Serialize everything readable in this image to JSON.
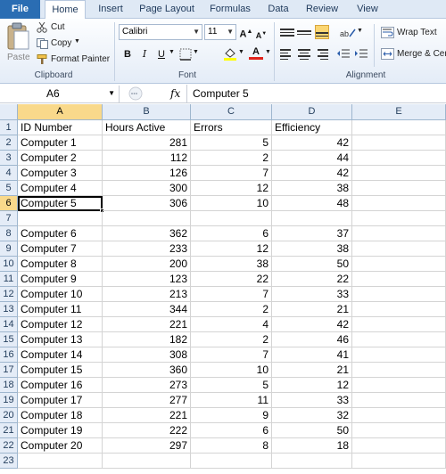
{
  "tabs": [
    "File",
    "Home",
    "Insert",
    "Page Layout",
    "Formulas",
    "Data",
    "Review",
    "View"
  ],
  "clipboard": {
    "paste_label": "Paste",
    "cut_label": "Cut",
    "copy_label": "Copy",
    "format_painter_label": "Format Painter",
    "group_label": "Clipboard"
  },
  "font": {
    "family": "Calibri",
    "size": "11",
    "bold": "B",
    "italic": "I",
    "underline": "U",
    "grow": "A",
    "shrink": "A",
    "color_glyph": "A",
    "group_label": "Font",
    "fill_color": "#ffff00",
    "font_color": "#e0231c"
  },
  "alignment": {
    "wrap_label": "Wrap Text",
    "merge_label": "Merge & Cer",
    "group_label": "Alignment"
  },
  "formula_bar": {
    "name_box": "A6",
    "fx": "fx",
    "content": "Computer 5"
  },
  "columns": [
    "A",
    "B",
    "C",
    "D",
    "E"
  ],
  "rows": [
    {
      "n": "1",
      "a": "ID Number",
      "b": "Hours Active",
      "c": "Errors",
      "d": "Efficiency"
    },
    {
      "n": "2",
      "a": "Computer 1",
      "b": "281",
      "c": "5",
      "d": "42"
    },
    {
      "n": "3",
      "a": "Computer 2",
      "b": "112",
      "c": "2",
      "d": "44"
    },
    {
      "n": "4",
      "a": "Computer 3",
      "b": "126",
      "c": "7",
      "d": "42"
    },
    {
      "n": "5",
      "a": "Computer 4",
      "b": "300",
      "c": "12",
      "d": "38"
    },
    {
      "n": "6",
      "a": "Computer 5",
      "b": "306",
      "c": "10",
      "d": "48"
    },
    {
      "n": "7",
      "a": "",
      "b": "",
      "c": "",
      "d": ""
    },
    {
      "n": "8",
      "a": "Computer 6",
      "b": "362",
      "c": "6",
      "d": "37"
    },
    {
      "n": "9",
      "a": "Computer 7",
      "b": "233",
      "c": "12",
      "d": "38"
    },
    {
      "n": "10",
      "a": "Computer 8",
      "b": "200",
      "c": "38",
      "d": "50"
    },
    {
      "n": "11",
      "a": "Computer 9",
      "b": "123",
      "c": "22",
      "d": "22"
    },
    {
      "n": "12",
      "a": "Computer 10",
      "b": "213",
      "c": "7",
      "d": "33"
    },
    {
      "n": "13",
      "a": "Computer 11",
      "b": "344",
      "c": "2",
      "d": "21"
    },
    {
      "n": "14",
      "a": "Computer 12",
      "b": "221",
      "c": "4",
      "d": "42"
    },
    {
      "n": "15",
      "a": "Computer 13",
      "b": "182",
      "c": "2",
      "d": "46"
    },
    {
      "n": "16",
      "a": "Computer 14",
      "b": "308",
      "c": "7",
      "d": "41"
    },
    {
      "n": "17",
      "a": "Computer 15",
      "b": "360",
      "c": "10",
      "d": "21"
    },
    {
      "n": "18",
      "a": "Computer 16",
      "b": "273",
      "c": "5",
      "d": "12"
    },
    {
      "n": "19",
      "a": "Computer 17",
      "b": "277",
      "c": "11",
      "d": "33"
    },
    {
      "n": "20",
      "a": "Computer 18",
      "b": "221",
      "c": "9",
      "d": "32"
    },
    {
      "n": "21",
      "a": "Computer 19",
      "b": "222",
      "c": "6",
      "d": "50"
    },
    {
      "n": "22",
      "a": "Computer 20",
      "b": "297",
      "b2": "",
      "c": "8",
      "d": "18"
    },
    {
      "n": "23",
      "a": "",
      "b": "",
      "c": "",
      "d": ""
    }
  ],
  "selection": {
    "row": "6",
    "col": "A"
  },
  "colors": {
    "file_tab": "#2a6db3",
    "header_selected": "#f9d98b",
    "ribbon_bg": "#e4ecf7"
  }
}
